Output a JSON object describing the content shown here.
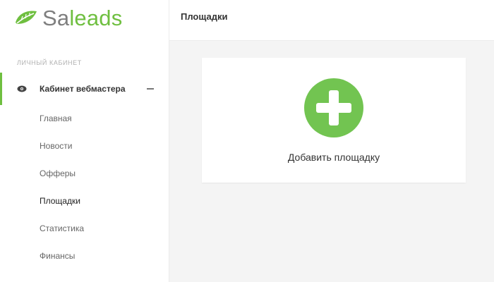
{
  "app": {
    "logo_text_prefix": "Sa",
    "logo_text_accent": "leads",
    "brand_color": "#6fbf40"
  },
  "sidebar": {
    "section_label": "ЛИЧНЫЙ КАБИНЕТ",
    "cabinet": {
      "label": "Кабинет вебмастера",
      "icon": "eye-icon",
      "expanded": true
    },
    "items": [
      {
        "label": "Главная",
        "active": false
      },
      {
        "label": "Новости",
        "active": false
      },
      {
        "label": "Офферы",
        "active": false
      },
      {
        "label": "Площадки",
        "active": true
      },
      {
        "label": "Статистика",
        "active": false
      },
      {
        "label": "Финансы",
        "active": false
      }
    ]
  },
  "header": {
    "title": "Площадки"
  },
  "main": {
    "add_card": {
      "label": "Добавить площадку",
      "icon": "plus-icon",
      "color": "#72c451"
    }
  }
}
